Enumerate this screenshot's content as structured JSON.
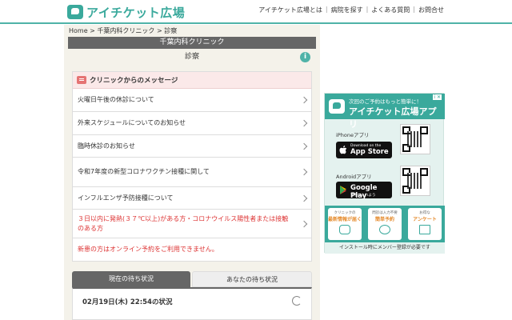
{
  "header": {
    "logo_text": "アイチケット広場",
    "nav": [
      "アイチケット広場とは",
      "病院を探す",
      "よくある質問",
      "お問合せ"
    ],
    "nav_sep": "|"
  },
  "breadcrumb": "Home > 千葉内科クリニック > 診察",
  "clinic_name": "千葉内科クリニック",
  "page_subtitle": "診察",
  "info_icon_glyph": "i",
  "messages": {
    "heading": "クリニックからのメッセージ",
    "items": [
      {
        "text": "火曜日午後の休診について",
        "red": false
      },
      {
        "text": "外来スケジュールについてのお知らせ",
        "red": false
      },
      {
        "text": "臨時休診のお知らせ",
        "red": false
      },
      {
        "text": "令和7年度の新型コロナワクチン接種に関して",
        "red": false
      },
      {
        "text": "インフルエンザ予防接種について",
        "red": false
      },
      {
        "text": "３日以内に発熱(３７℃以上)がある方・コロナウイルス陽性者または接触のある方",
        "red": true
      },
      {
        "text": "新患の方はオンライン予約をご利用できません。",
        "red": true
      }
    ]
  },
  "tabs": {
    "current": "現在の待ち状況",
    "mine": "あなたの待ち状況"
  },
  "status_line": "02月19日(木) 22:54の状況",
  "ad": {
    "ad_mark": "i ✕",
    "line1": "次回のご予約はもっと簡単に！",
    "line2": "アイチケット広場アプリ",
    "iphone_label": "iPhoneアプリ",
    "appstore_small": "Download on the",
    "appstore_big": "App Store",
    "android_label": "Androidアプリ",
    "play_big": "Google Play",
    "play_small": "で手に入れよう",
    "features": [
      {
        "t1": "クリニックの",
        "t2": "最新情報が届く"
      },
      {
        "t1": "問診は入力不要",
        "t2": "簡単予約"
      },
      {
        "t1": "お得な",
        "t2": "アンケート"
      }
    ],
    "footer": "インストール時にメンバー登録が必要です"
  },
  "colors": {
    "brand": "#3aa99c",
    "alert_red": "#dd3333",
    "dark_bar": "#666666"
  }
}
